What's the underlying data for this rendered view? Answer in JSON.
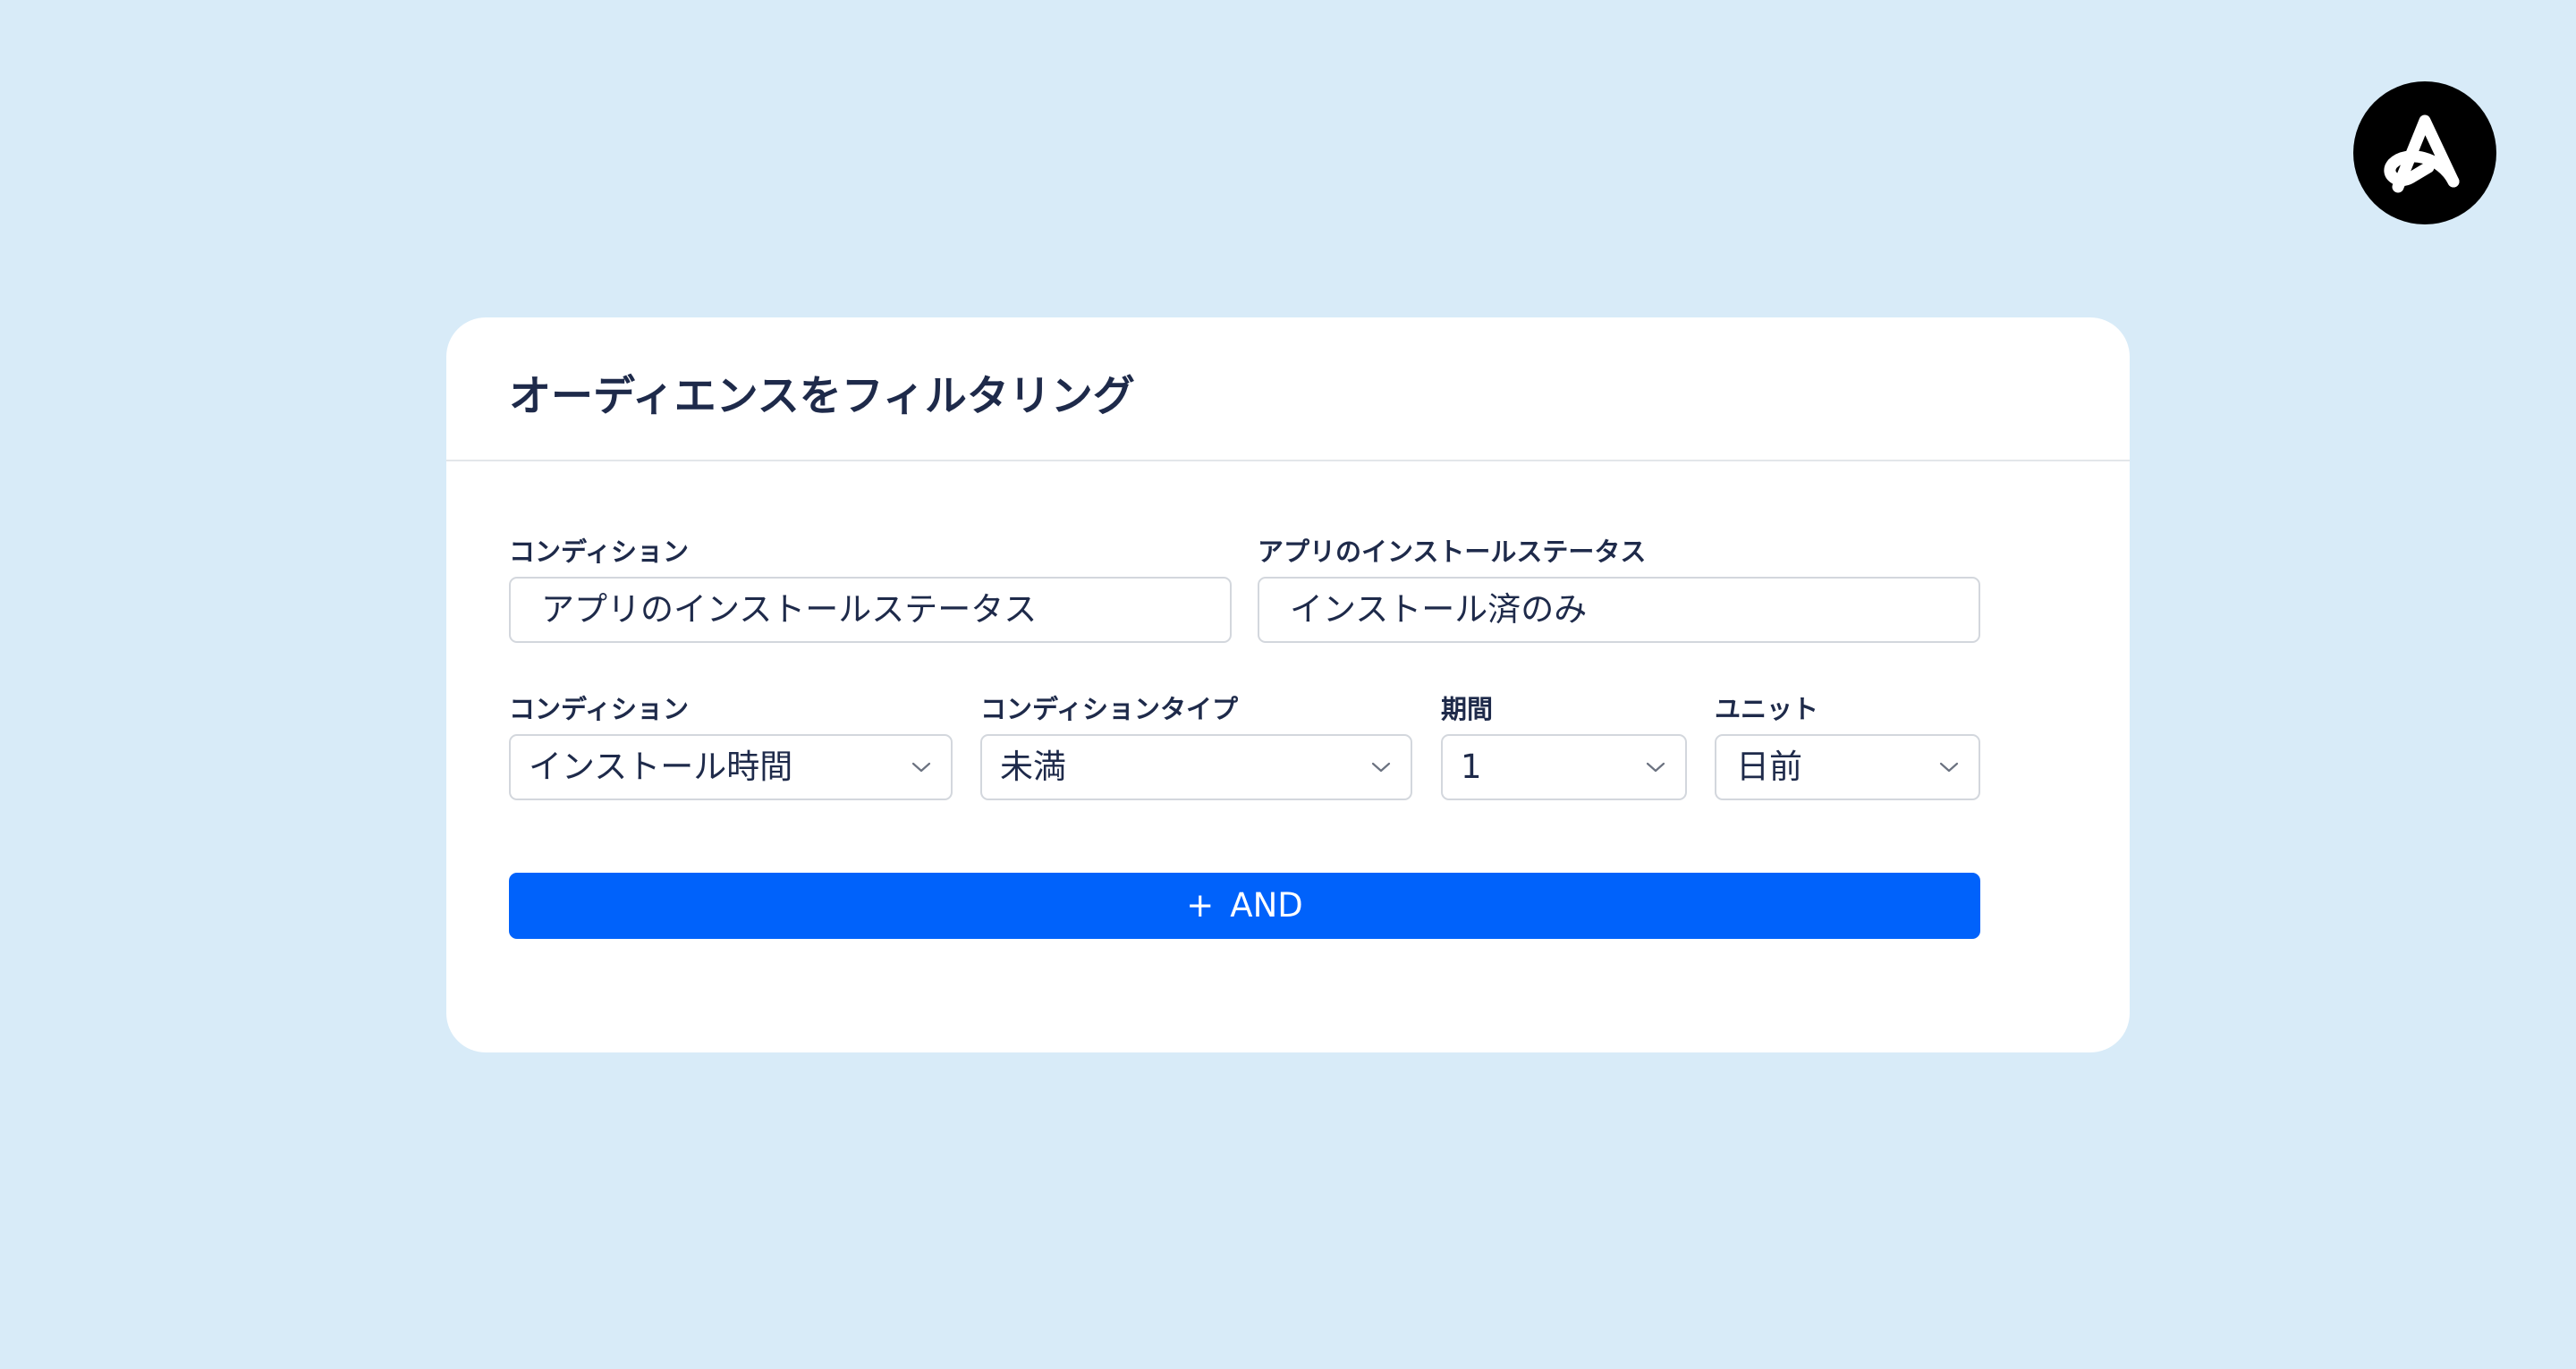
{
  "brand": {
    "logo_icon": "adjust-logo-icon",
    "background_color": "#d8ebf8",
    "accent_color": "#0062fb"
  },
  "card": {
    "title": "オーディエンスをフィルタリング"
  },
  "row1": {
    "condition": {
      "label": "コンディション",
      "value": "アプリのインストールステータス"
    },
    "install_status": {
      "label": "アプリのインストールステータス",
      "value": "インストール済のみ"
    }
  },
  "row2": {
    "condition": {
      "label": "コンディション",
      "value": "インストール時間",
      "icon": "chevron-down-icon"
    },
    "condition_type": {
      "label": "コンディションタイプ",
      "value": "未満",
      "icon": "chevron-down-icon"
    },
    "period": {
      "label": "期間",
      "value": "1",
      "icon": "chevron-down-icon"
    },
    "unit": {
      "label": "ユニット",
      "value": "日前",
      "icon": "chevron-down-icon"
    }
  },
  "and_button": {
    "plus": "+",
    "label": "AND"
  }
}
